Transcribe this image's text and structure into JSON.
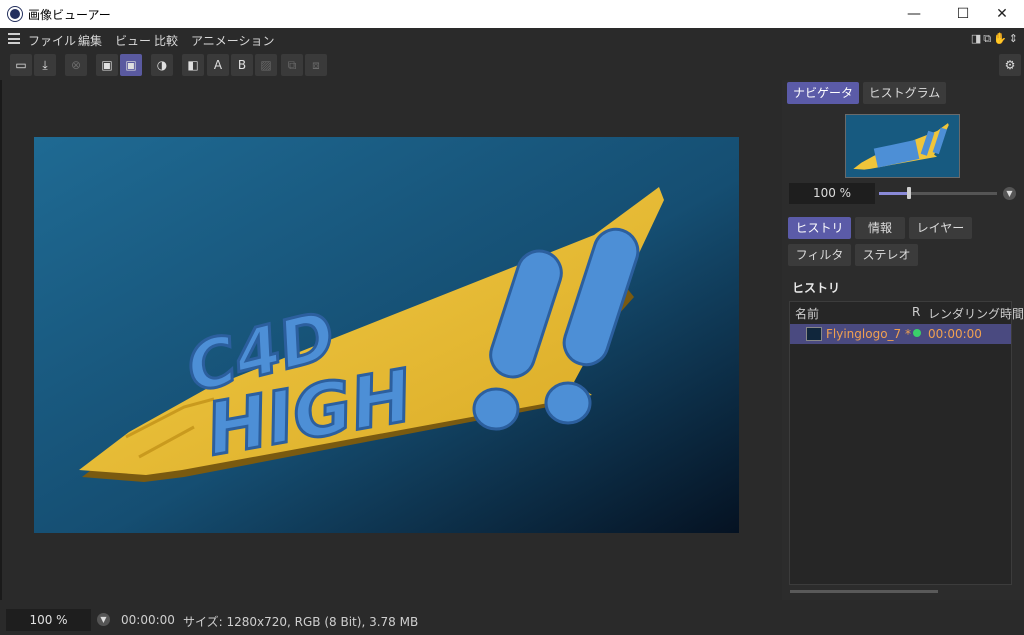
{
  "window": {
    "title": "画像ビューアー",
    "minimize": "—",
    "maximize": "☐",
    "close": "✕"
  },
  "menu": {
    "items": [
      "ファイル",
      "編集",
      "ビュー",
      "比較",
      "アニメーション"
    ]
  },
  "toolbar": {
    "buttons": [
      {
        "icon": "folder-icon",
        "glyph": "▭"
      },
      {
        "icon": "save-icon",
        "glyph": "⤓"
      },
      {
        "icon": "stop-icon",
        "glyph": "⊗"
      },
      {
        "icon": "region-render-icon",
        "glyph": "▣"
      },
      {
        "icon": "active-region-icon",
        "glyph": "▣"
      },
      {
        "icon": "contrast-icon",
        "glyph": "◑"
      },
      {
        "icon": "compare-icon",
        "glyph": "◧"
      },
      {
        "label": "A"
      },
      {
        "label": "B"
      },
      {
        "icon": "image-icon",
        "glyph": "▨"
      },
      {
        "icon": "swap-icon",
        "glyph": "⧉"
      },
      {
        "icon": "swap-b-icon",
        "glyph": "⧈"
      }
    ]
  },
  "render": {
    "text_line1": "C4D",
    "text_line2": "HIGH",
    "bang": "!!"
  },
  "panel": {
    "tabs_top": [
      "ナビゲータ",
      "ヒストグラム"
    ],
    "zoom_value": "100 %",
    "zoom_slider_fraction": 0.25,
    "tabs_bottom": [
      "ヒストリ",
      "情報",
      "レイヤー",
      "フィルタ",
      "ステレオ"
    ],
    "history_title": "ヒストリ",
    "history_columns": {
      "name": "名前",
      "r": "R",
      "time": "レンダリング時間"
    },
    "history_rows": [
      {
        "name": "Flyinglogo_7 *",
        "time": "00:00:00",
        "status_color": "#3ad16a"
      }
    ]
  },
  "status": {
    "zoom": "100 %",
    "time": "00:00:00",
    "info": "サイズ: 1280x720, RGB (8 Bit), 3.78 MB"
  },
  "colors": {
    "accent": "#5b5ba8",
    "render_bg_top": "#1f6a93",
    "render_bg_bottom": "#051222",
    "logo_yellow": "#f0c53a",
    "logo_blue": "#4d8fd6",
    "history_text": "#f0a050"
  }
}
